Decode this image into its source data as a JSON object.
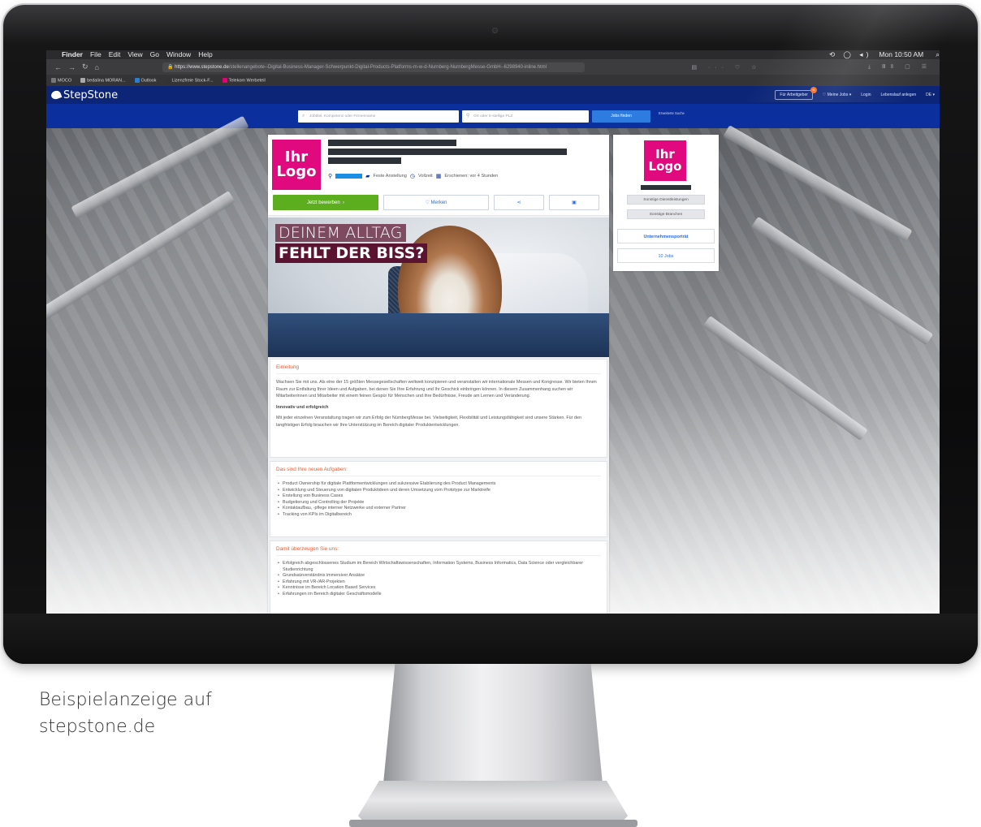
{
  "caption": {
    "line1": "Beispielanzeige auf",
    "line2": "stepstone.de"
  },
  "menubar": {
    "items": [
      "Finder",
      "File",
      "Edit",
      "View",
      "Go",
      "Window",
      "Help"
    ],
    "clock": "Mon 10:50 AM"
  },
  "browser": {
    "url_domain": "https://www.stepstone.de",
    "url_path": "/stellenangebote--Digital-Business-Manager-Schwerpunkt-Digital-Products-Platforms-m-w-d-Nurnberg-NurnbergMesse-GmbH--6298940-inline.html",
    "bookmarks": [
      "MOCO",
      "bedalina MORAN...",
      "Outlook",
      "Lizenzfreie Stock-F...",
      "Telekom Werbeteil"
    ]
  },
  "header": {
    "brand": "StepStone",
    "fuer_arbeitgeber": "Für Arbeitgeber",
    "badge_count": "N",
    "meine_jobs": "Meine Jobs",
    "login": "Login",
    "lebenslauf": "Lebenslauf anlegen",
    "lang": "DE"
  },
  "search": {
    "what_placeholder": "Jobtitel, Kompetenz oder Firmenname",
    "where_placeholder": "Ort oder 5-stellige PLZ",
    "button": "Jobs finden",
    "advanced": "Erweiterte Suche"
  },
  "job": {
    "logo_line1": "Ihr",
    "logo_line2": "Logo",
    "contract": "Feste Anstellung",
    "time": "Vollzeit",
    "published": "Erschienen: vor 4 Stunden",
    "apply": "Jetzt bewerben",
    "save": "Merken",
    "hero_line1": "DEINEM ALLTAG",
    "hero_line2": "FEHLT DER BISS?"
  },
  "sections": {
    "intro_title": "Einleitung",
    "intro_p1": "Wachsen Sie mit uns. Als eine der 15 größten Messegesellschaften weltweit konzipieren und veranstalten wir internationale Messen und Kongresse. Wir bieten Ihnen Raum zur Entfaltung Ihrer Ideen und Aufgaben, bei denen Sie Ihre Erfahrung und Ihr Geschick einbringen können. In diesem Zusammenhang suchen wir Mitarbeiterinnen und Mitarbeiter mit einem feinen Gespür für Menschen und ihre Bedürfnisse, Freude am Lernen und Veränderung.",
    "intro_sub": "Innovativ und erfolgreich",
    "intro_p2": "Mit jeder einzelnen Veranstaltung tragen wir zum Erfolg der NürnbergMesse bei. Vielseitigkeit, Flexibilität und Leistungsfähigkeit sind unsere Stärken. Für den langfristigen Erfolg brauchen wir Ihre Unterstützung im Bereich digitaler Produktentwicklungen.",
    "tasks_title": "Das sind Ihre neuen Aufgaben:",
    "tasks": [
      "Product Ownership für digitale Plattformentwicklungen und sukzessive Etablierung des Product Managements",
      "Entwicklung und Steuerung von digitalen Produktideen und deren Umsetzung vom Prototype zur Marktreife",
      "Erstellung von Business Cases",
      "Budgetierung und Controlling der Projekte",
      "Kontaktaufbau, -pflege interner Netzwerke und externer Partner",
      "Tracking von KPIs im Digitalbereich"
    ],
    "profile_title": "Damit überzeugen Sie uns:",
    "profile": [
      "Erfolgreich abgeschlossenes Studium im Bereich Wirtschaftswissenschaften, Information Systems, Business Informatics, Data Science oder vergleichbarer Studienrichtung",
      "Grundsatzverständnis immersiver Ansätze",
      "Erfahrung mit VR-/AR-Projekten",
      "Kenntnisse im Bereich Location Based Services",
      "Erfahrungen im Bereich digitaler Geschäftsmodelle"
    ]
  },
  "company": {
    "logo_line1": "Ihr",
    "logo_line2": "Logo",
    "tag1": "Sonstige Dienstleistungen",
    "tag2": "Sonstige Branchen",
    "portrait": "Unternehmensporträt",
    "jobs": "10 Jobs"
  },
  "colors": {
    "brand_navy": "#0c2577",
    "apply_green": "#5cae1e",
    "logo_magenta": "#e0097d",
    "section_orange": "#f0592c"
  }
}
